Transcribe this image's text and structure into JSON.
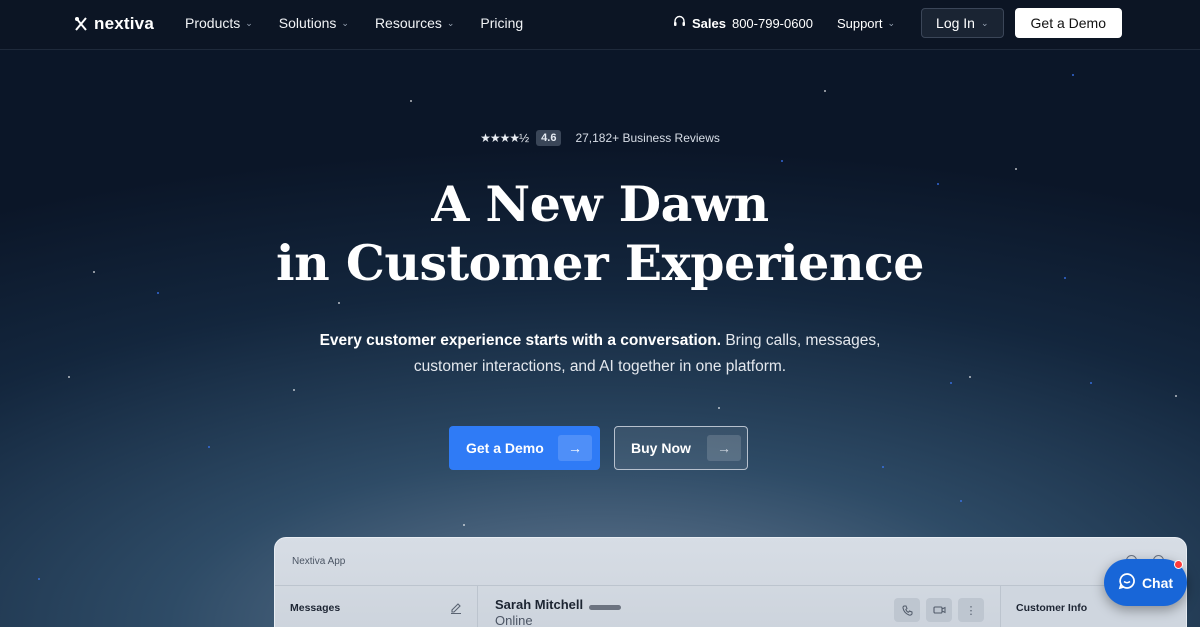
{
  "brand": {
    "name": "nextiva"
  },
  "nav": {
    "menu": [
      {
        "label": "Products",
        "has_dropdown": true
      },
      {
        "label": "Solutions",
        "has_dropdown": true
      },
      {
        "label": "Resources",
        "has_dropdown": true
      },
      {
        "label": "Pricing",
        "has_dropdown": false
      }
    ],
    "sales_label": "Sales",
    "sales_phone": "800-799-0600",
    "support_label": "Support",
    "login_label": "Log In",
    "demo_label": "Get a Demo"
  },
  "hero": {
    "rating_stars": "★★★★½",
    "rating_value": "4.6",
    "reviews_text": "27,182+ Business Reviews",
    "headline_line1": "A New Dawn",
    "headline_line2": "in Customer Experience",
    "sub_bold": "Every customer experience starts with a conversation.",
    "sub_rest_1": " Bring calls, messages,",
    "sub_rest_2": "customer interactions, and AI together in one platform.",
    "cta_primary": "Get a Demo",
    "cta_secondary": "Buy Now",
    "arrow": "→"
  },
  "app_preview": {
    "title": "Nextiva App",
    "messages_label": "Messages",
    "contact_name": "Sarah Mitchell",
    "contact_status": "Online",
    "info_label": "Customer Info"
  },
  "chat_widget": {
    "label": "Chat"
  },
  "colors": {
    "nav_bg": "#0c1524",
    "primary_blue": "#2f7bf6",
    "chat_blue": "#1866d8"
  }
}
